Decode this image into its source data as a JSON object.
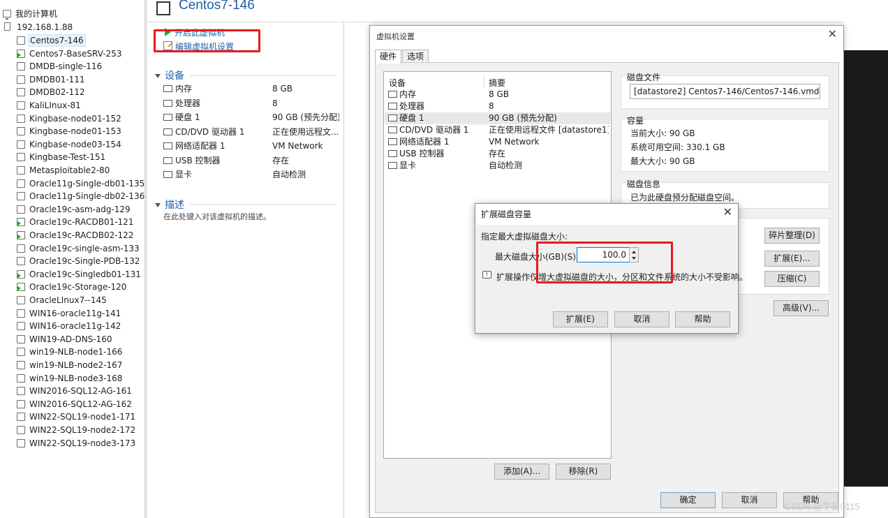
{
  "tree": {
    "root": "我的计算机",
    "host": "192.168.1.88",
    "vms": [
      {
        "name": "Centos7-146",
        "selected": true,
        "on": false
      },
      {
        "name": "Centos7-BaseSRV-253",
        "on": true
      },
      {
        "name": "DMDB-single-116",
        "on": false
      },
      {
        "name": "DMDB01-111",
        "on": false
      },
      {
        "name": "DMDB02-112",
        "on": false
      },
      {
        "name": "KaliLInux-81",
        "on": false
      },
      {
        "name": "Kingbase-node01-152",
        "on": false
      },
      {
        "name": "Kingbase-node01-153",
        "on": false
      },
      {
        "name": "Kingbase-node03-154",
        "on": false
      },
      {
        "name": "Kingbase-Test-151",
        "on": false
      },
      {
        "name": "Metasploitable2-80",
        "on": false
      },
      {
        "name": "Oracle11g-Single-db01-135",
        "on": false
      },
      {
        "name": "Oracle11g-Single-db02-136",
        "on": false
      },
      {
        "name": "Oracle19c-asm-adg-129",
        "on": false
      },
      {
        "name": "Oracle19c-RACDB01-121",
        "on": true
      },
      {
        "name": "Oracle19c-RACDB02-122",
        "on": true
      },
      {
        "name": "Oracle19c-single-asm-133",
        "on": false
      },
      {
        "name": "Oracle19c-Single-PDB-132",
        "on": false
      },
      {
        "name": "Oracle19c-Singledb01-131",
        "on": true
      },
      {
        "name": "Oracle19c-Storage-120",
        "on": true
      },
      {
        "name": "OracleLInux7--145",
        "on": false
      },
      {
        "name": "WIN16-oracle11g-141",
        "on": false
      },
      {
        "name": "WIN16-oracle11g-142",
        "on": false
      },
      {
        "name": "WIN19-AD-DNS-160",
        "on": false
      },
      {
        "name": "win19-NLB-node1-166",
        "on": false
      },
      {
        "name": "win19-NLB-node2-167",
        "on": false
      },
      {
        "name": "win19-NLB-node3-168",
        "on": false
      },
      {
        "name": "WIN2016-SQL12-AG-161",
        "on": false
      },
      {
        "name": "WIN2016-SQL12-AG-162",
        "on": false
      },
      {
        "name": "WIN22-SQL19-node1-171",
        "on": false
      },
      {
        "name": "WIN22-SQL19-node2-172",
        "on": false
      },
      {
        "name": "WIN22-SQL19-node3-173",
        "on": false
      }
    ]
  },
  "vm_panel": {
    "title": "Centos7-146",
    "power_action": "开启此虚拟机",
    "edit_action": "编辑虚拟机设置",
    "devices_heading": "设备",
    "devices": [
      {
        "name": "内存",
        "value": "8 GB",
        "icon": "memory-icon"
      },
      {
        "name": "处理器",
        "value": "8",
        "icon": "cpu-icon"
      },
      {
        "name": "硬盘 1",
        "value": "90 GB (预先分配)",
        "icon": "harddisk-icon"
      },
      {
        "name": "CD/DVD 驱动器 1",
        "value": "正在使用远程文...",
        "icon": "cdrom-icon"
      },
      {
        "name": "网络适配器 1",
        "value": "VM Network",
        "icon": "network-icon"
      },
      {
        "name": "USB 控制器",
        "value": "存在",
        "icon": "usb-icon"
      },
      {
        "name": "显卡",
        "value": "自动检测",
        "icon": "display-icon"
      }
    ],
    "description_heading": "描述",
    "description_placeholder": "在此处键入对该虚拟机的描述。"
  },
  "settings": {
    "title": "虚拟机设置",
    "tabs": [
      "硬件",
      "选项"
    ],
    "list_header": {
      "device": "设备",
      "summary": "摘要"
    },
    "devices": [
      {
        "name": "内存",
        "value": "8 GB"
      },
      {
        "name": "处理器",
        "value": "8"
      },
      {
        "name": "硬盘 1",
        "value": "90 GB (预先分配)",
        "selected": true
      },
      {
        "name": "CD/DVD 驱动器 1",
        "value": "正在使用远程文件 [datastore1]..."
      },
      {
        "name": "网络适配器 1",
        "value": "VM Network"
      },
      {
        "name": "USB 控制器",
        "value": "存在"
      },
      {
        "name": "显卡",
        "value": "自动检测"
      }
    ],
    "add_button": "添加(A)...",
    "remove_button": "移除(R)",
    "disk_file": {
      "title": "磁盘文件",
      "value": "[datastore2] Centos7-146/Centos7-146.vmdk"
    },
    "capacity": {
      "title": "容量",
      "current": "当前大小: 90 GB",
      "available": "系统可用空间: 330.1 GB",
      "max": "最大大小: 90 GB"
    },
    "disk_info": {
      "title": "磁盘信息",
      "text": "已为此硬盘预分配磁盘空间。"
    },
    "defrag_button": "碎片整理(D)",
    "expand_button": "扩展(E)...",
    "compact_button": "压缩(C)",
    "advanced_button": "高级(V)...",
    "ok_button": "确定",
    "cancel_button": "取消",
    "help_button": "帮助"
  },
  "expand_dialog": {
    "title": "扩展磁盘容量",
    "prompt": "指定最大虚拟磁盘大小:",
    "size_label": "最大磁盘大小(GB)(S):",
    "size_value": "100.0",
    "note": "扩展操作仅增大虚拟磁盘的大小，分区和文件系统的大小不受影响。",
    "expand_button": "扩展(E)",
    "cancel_button": "取消",
    "help_button": "帮助"
  },
  "watermark": "CSDN @李哥0115",
  "colors": {
    "highlight_red": "#e8191c",
    "link_blue": "#1f5fa8",
    "power_green": "#2ea32e"
  }
}
